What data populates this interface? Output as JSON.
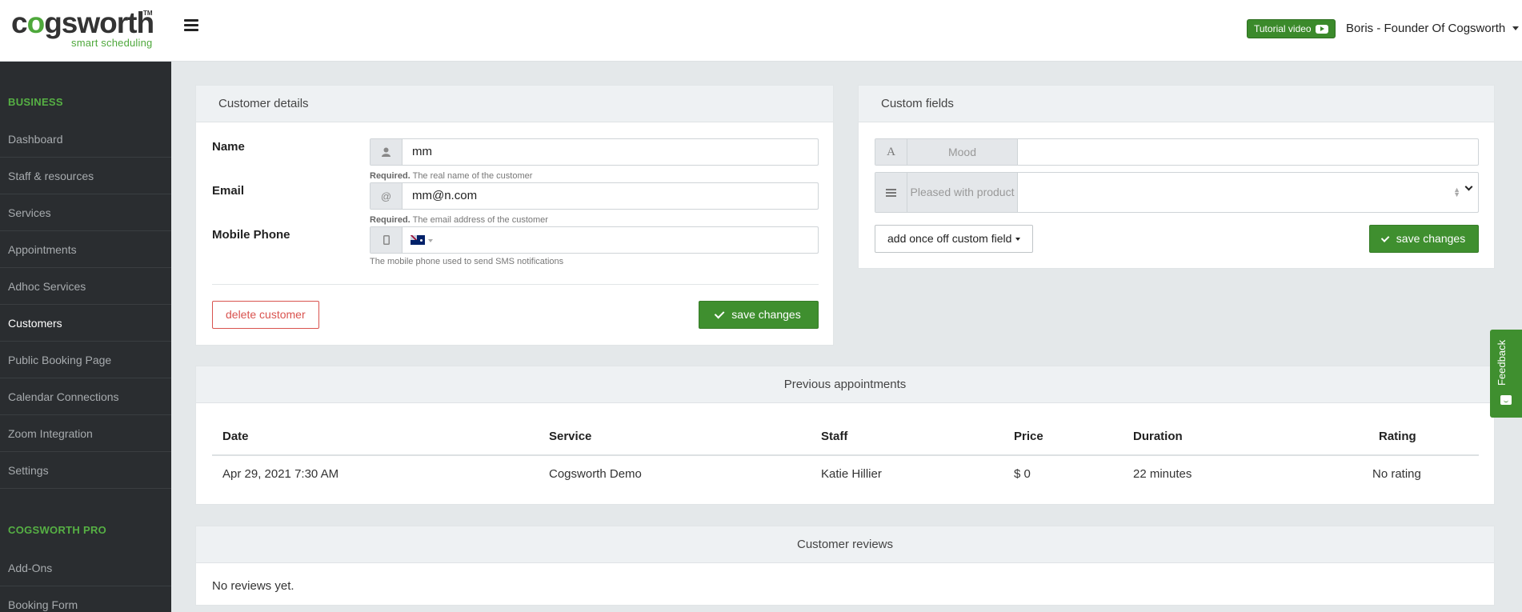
{
  "header": {
    "logo_text_a": "c",
    "logo_text_gear": "o",
    "logo_text_b": "gsworth",
    "logo_tm": "TM",
    "logo_sub": "smart scheduling",
    "tutorial_label": "Tutorial video",
    "user_label": "Boris - Founder Of Cogsworth"
  },
  "sidebar": {
    "section_business": "BUSINESS",
    "items": [
      {
        "label": "Dashboard"
      },
      {
        "label": "Staff & resources"
      },
      {
        "label": "Services"
      },
      {
        "label": "Appointments"
      },
      {
        "label": "Adhoc Services"
      },
      {
        "label": "Customers"
      },
      {
        "label": "Public Booking Page"
      },
      {
        "label": "Calendar Connections"
      },
      {
        "label": "Zoom Integration"
      },
      {
        "label": "Settings"
      }
    ],
    "active_item": "Customers",
    "section_pro": "COGSWORTH PRO",
    "pro_items": [
      {
        "label": "Add-Ons"
      },
      {
        "label": "Booking Form"
      }
    ]
  },
  "customer_details": {
    "title": "Customer details",
    "name_label": "Name",
    "name_value": "mm",
    "name_help_required": "Required.",
    "name_help": "The real name of the customer",
    "email_label": "Email",
    "email_value": "mm@n.com",
    "email_addon": "@",
    "email_help_required": "Required.",
    "email_help": "The email address of the customer",
    "phone_label": "Mobile Phone",
    "phone_help": "The mobile phone used to send SMS notifications",
    "delete_label": "delete customer",
    "save_label": "save changes"
  },
  "custom_fields": {
    "title": "Custom fields",
    "fields": [
      {
        "icon": "A",
        "name": "Mood",
        "value": ""
      },
      {
        "icon": "list",
        "name": "Pleased with product",
        "value": ""
      }
    ],
    "add_label": "add once off custom field",
    "save_label": "save changes"
  },
  "previous_appointments": {
    "title": "Previous appointments",
    "columns": [
      "Date",
      "Service",
      "Staff",
      "Price",
      "Duration",
      "Rating"
    ],
    "rows": [
      [
        "Apr 29, 2021 7:30 AM",
        "Cogsworth Demo",
        "Katie Hillier",
        "$ 0",
        "22 minutes",
        "No rating"
      ]
    ]
  },
  "customer_reviews": {
    "title": "Customer reviews",
    "empty_text": "No reviews yet."
  },
  "feedback": {
    "label": "Feedback"
  },
  "colors": {
    "brand_green": "#4ea83b",
    "button_green": "#3f8f2f",
    "danger": "#d9534f",
    "sidebar_bg": "#2a2d30"
  }
}
